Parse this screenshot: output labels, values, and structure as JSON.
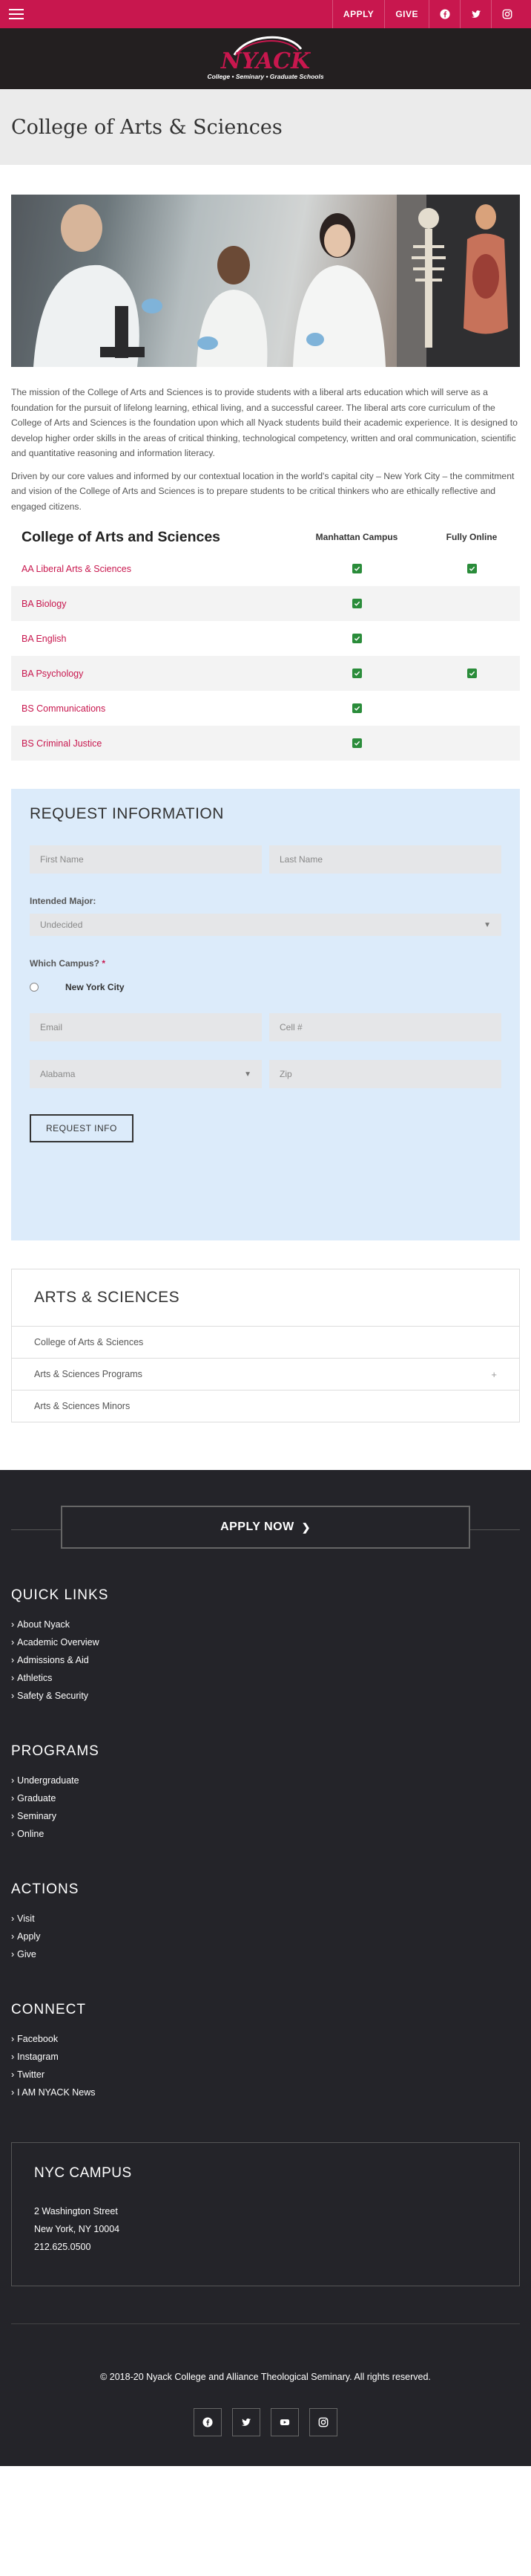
{
  "header": {
    "nav": [
      "APPLY",
      "GIVE"
    ],
    "social_icons": [
      "facebook-icon",
      "twitter-icon",
      "instagram-icon"
    ],
    "logo_text": "NYACK",
    "logo_tagline": "College • Seminary • Graduate Schools",
    "brand_color": "#c8174e"
  },
  "page": {
    "title": "College of Arts & Sciences",
    "paragraphs": [
      "The mission of the College of Arts and Sciences is to provide students with a liberal arts education which will serve as a foundation for the pursuit of lifelong learning, ethical living, and a successful career. The liberal arts core curriculum of the College of Arts and Sciences is the foundation upon which all Nyack students build their academic experience. It is designed to develop higher order skills in the areas of critical thinking, technological competency, written and oral communication, scientific and quantitative reasoning and information literacy.",
      "Driven by our core values and informed by our contextual location in the world's capital city – New York City – the commitment and vision of the College of Arts and Sciences is to prepare students to be critical thinkers who are ethically reflective and engaged citizens."
    ]
  },
  "programs": {
    "title": "College of Arts and Sciences",
    "col_manhattan": "Manhattan Campus",
    "col_online": "Fully Online",
    "rows": [
      {
        "name": "AA Liberal Arts & Sciences",
        "manhattan": true,
        "online": true
      },
      {
        "name": "BA Biology",
        "manhattan": true,
        "online": false
      },
      {
        "name": "BA English",
        "manhattan": true,
        "online": false
      },
      {
        "name": "BA Psychology",
        "manhattan": true,
        "online": true
      },
      {
        "name": "BS Communications",
        "manhattan": true,
        "online": false
      },
      {
        "name": "BS Criminal Justice",
        "manhattan": true,
        "online": false
      }
    ]
  },
  "form": {
    "title": "REQUEST INFORMATION",
    "first_name_placeholder": "First Name",
    "last_name_placeholder": "Last Name",
    "major_label": "Intended Major:",
    "major_value": "Undecided",
    "campus_label": "Which Campus?",
    "campus_required": "*",
    "campus_option": "New York City",
    "email_placeholder": "Email",
    "cell_placeholder": "Cell #",
    "state_value": "Alabama",
    "zip_placeholder": "Zip",
    "submit_label": "REQUEST INFO"
  },
  "subnav": {
    "title": "ARTS & SCIENCES",
    "items": [
      {
        "label": "College of Arts & Sciences",
        "expand": ""
      },
      {
        "label": "Arts & Sciences Programs",
        "expand": "+"
      },
      {
        "label": "Arts & Sciences Minors",
        "expand": ""
      }
    ]
  },
  "footer": {
    "apply_label": "APPLY NOW",
    "quick_links_title": "QUICK LINKS",
    "quick_links": [
      "About Nyack",
      "Academic Overview",
      "Admissions & Aid",
      "Athletics",
      "Safety & Security"
    ],
    "programs_title": "PROGRAMS",
    "programs": [
      "Undergraduate",
      "Graduate",
      "Seminary",
      "Online"
    ],
    "actions_title": "ACTIONS",
    "actions": [
      "Visit",
      "Apply",
      "Give"
    ],
    "connect_title": "CONNECT",
    "connect": [
      "Facebook",
      "Instagram",
      "Twitter",
      "I AM NYACK News"
    ],
    "campus_title": "NYC CAMPUS",
    "campus_address_1": "2 Washington Street",
    "campus_address_2": "New York, NY 10004",
    "campus_phone": "212.625.0500",
    "copyright": "© 2018-20 Nyack College and Alliance Theological Seminary. All rights reserved.",
    "social_icons": [
      "facebook-icon",
      "twitter-icon",
      "youtube-icon",
      "instagram-icon"
    ]
  }
}
